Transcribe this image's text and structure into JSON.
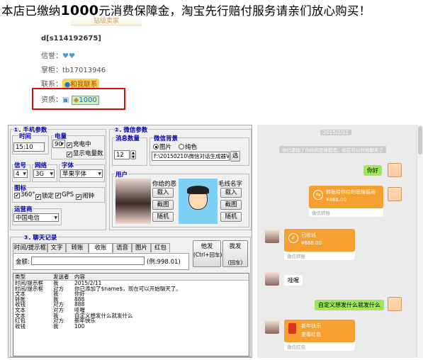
{
  "headline": {
    "pre": "本店已缴纳",
    "amount": "1000",
    "post": "元消费保障金，淘宝先行赔付服务请亲们放心购买！"
  },
  "seller": {
    "banner": "钻级卖家",
    "name": "d[s114192675]",
    "credit_label": "信誉：",
    "shopkeeper_label": "掌柜：",
    "shopkeeper": "tb17013946",
    "contact_label": "联系：",
    "contact_button": "和我联系",
    "qualification_label": "资质：",
    "deposit": "1000"
  },
  "app": {
    "phone_group": "①. 手机参数",
    "time_label": "时间",
    "time_value": "15:10",
    "battery_label": "电量",
    "battery_value": "90",
    "charging": "充电中",
    "show_battery": "显示电量数",
    "signal_label": "信号",
    "signal_value": "4",
    "network_label": "网络",
    "network_value": "3G",
    "font_label": "字体",
    "font_value": "苹果字体",
    "icon_label": "图标",
    "icons": [
      "360°",
      "锁定",
      "GPS",
      "闹钟"
    ],
    "carrier_label": "运营商",
    "carrier_value": "中国电信",
    "wechat_group": "②. 微信参数",
    "unread_label": "消息数量",
    "unread_value": "12",
    "bg_label": "微信背景",
    "bg_opt_image": "图片",
    "bg_opt_solid": "纯色",
    "bg_path": "F:\\20150210\\微信对话生成器V",
    "choose_btn": "选",
    "user_label": "用户",
    "partner_label": "你给的恶",
    "partner_label2": "毛线名字",
    "load_btn": "载入",
    "shot_btn": "截图",
    "random_btn": "随机",
    "chat_group": "③. 聊天记录",
    "tabs": [
      "时间/提示框",
      "文字",
      "转账",
      "收账",
      "语音",
      "图片",
      "红包"
    ],
    "amount_label": "金额:",
    "amount_hint": "(例:998.01)",
    "send_other": "他发",
    "send_other_sub": "(Ctrl+回车)",
    "send_me": "我发",
    "send_me_sub": "(回车)",
    "table_headers": [
      "类型",
      "发送者",
      "内容"
    ],
    "rows": [
      [
        "时间/提示框",
        "我",
        "2015/2/11"
      ],
      [
        "时间/提示框",
        "对方",
        "你已添加了$name$，现在可以开始聊天了。"
      ],
      [
        "文本",
        "我",
        "你好"
      ],
      [
        "转账",
        "我",
        "888"
      ],
      [
        "收钱",
        "对方",
        "888"
      ],
      [
        "文本",
        "对方",
        "哇喔"
      ],
      [
        "文本",
        "我",
        "自定义想发什么就发什么"
      ],
      [
        "红包",
        "对方",
        "新年快乐"
      ],
      [
        "收钱",
        "我",
        "100"
      ]
    ]
  },
  "chat": {
    "date": "2015/2/11",
    "notice": "你已添加了你给的恶搜狐雨，现在可以开始聊天了",
    "hello": "你好",
    "transfer_me_title": "转账给你给的恶搜狐雨",
    "transfer_me_amount": "¥888.00",
    "transfer_me_foot": "微信转账",
    "received_title": "已收钱",
    "received_amount": "¥888.00",
    "received_foot": "微信转账",
    "wow": "哇喔",
    "custom": "自定义想发什么就发什么",
    "redpacket_title": "新年快乐",
    "redpacket_sub": "查看红包",
    "redpacket_foot": "微信红包"
  }
}
